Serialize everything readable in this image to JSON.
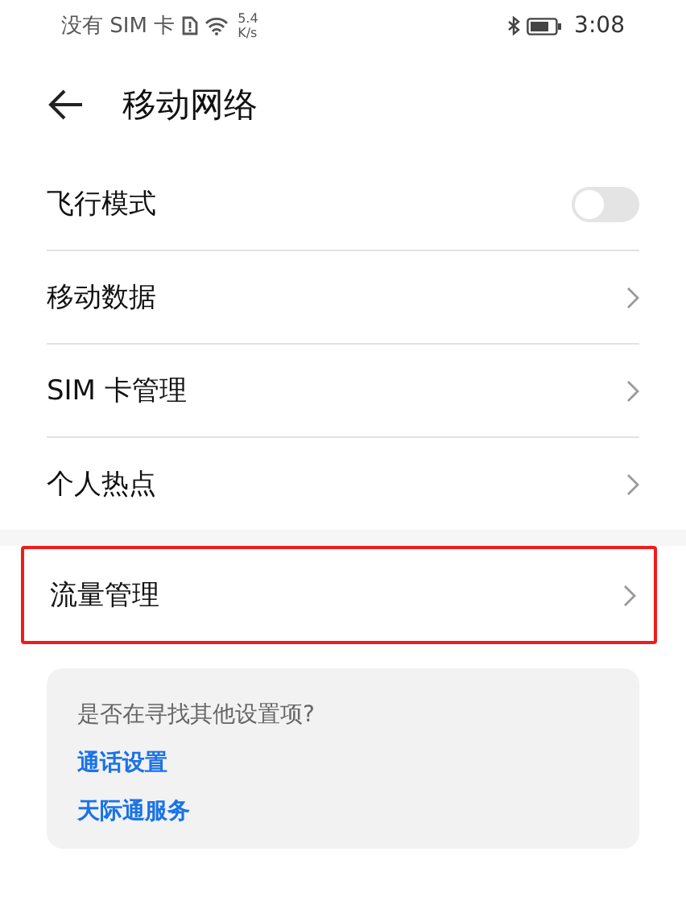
{
  "status_bar": {
    "carrier": "没有 SIM 卡",
    "speed_value": "5.4",
    "speed_unit": "K/s",
    "time": "3:08"
  },
  "header": {
    "title": "移动网络"
  },
  "groups": [
    {
      "highlighted": false,
      "items": [
        {
          "kind": "toggle",
          "label": "飞行模式",
          "on": false
        },
        {
          "kind": "link",
          "label": "移动数据"
        },
        {
          "kind": "link",
          "label": "SIM 卡管理"
        },
        {
          "kind": "link",
          "label": "个人热点"
        }
      ]
    },
    {
      "highlighted": true,
      "items": [
        {
          "kind": "link",
          "label": "流量管理"
        }
      ]
    }
  ],
  "suggestions": {
    "question": "是否在寻找其他设置项?",
    "links": [
      "通话设置",
      "天际通服务"
    ]
  }
}
